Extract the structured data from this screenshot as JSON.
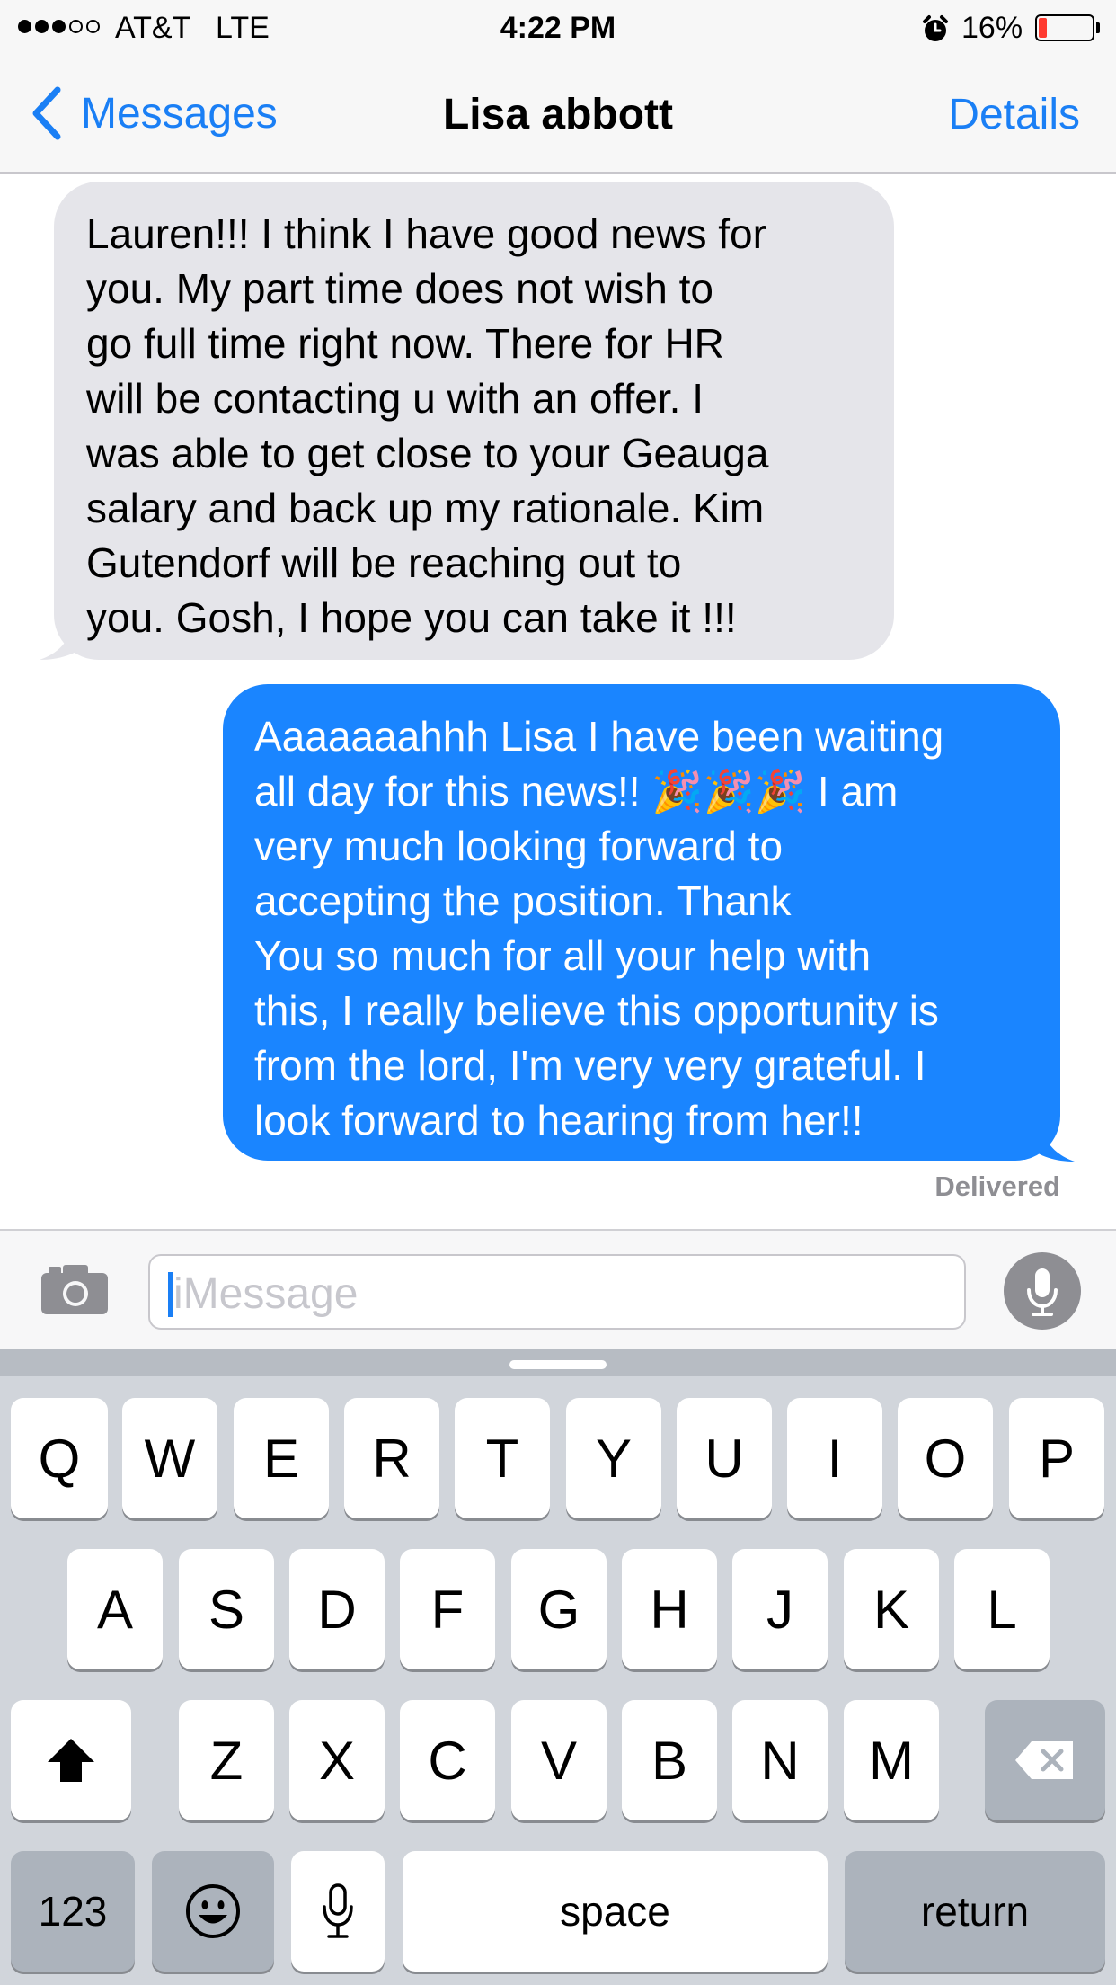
{
  "status_bar": {
    "signal": [
      true,
      true,
      true,
      false,
      false
    ],
    "carrier": "AT&T",
    "network": "LTE",
    "time": "4:22 PM",
    "alarm_icon": "alarm-clock-icon",
    "battery_percent": "16%",
    "battery_level": 0.16,
    "battery_color": "#ff3b30"
  },
  "nav": {
    "back_label": "Messages",
    "title": "Lisa abbott",
    "details_label": "Details"
  },
  "messages": [
    {
      "direction": "incoming",
      "text": "Lauren!!! I think I have good news for\nyou. My part time does not wish to\ngo full time right now. There for HR\nwill be contacting u with an offer. I\nwas able to get close to your Geauga\nsalary and back up my rationale. Kim\nGutendorf will be reaching out to\nyou. Gosh, I hope you can take it !!!"
    },
    {
      "direction": "outgoing",
      "text": "Aaaaaaahhh Lisa I have been waiting\nall day for this news!! 🎉🎉🎉 I am\nvery much looking forward to\naccepting the position. Thank\nYou so much for all your help with\nthis, I really believe this opportunity is\nfrom the lord, I'm very very grateful. I\nlook forward to hearing from her!!",
      "status": "Delivered"
    }
  ],
  "input_bar": {
    "camera_icon": "camera-icon",
    "placeholder": "iMessage",
    "mic_icon": "microphone-icon"
  },
  "keyboard": {
    "row1": [
      "Q",
      "W",
      "E",
      "R",
      "T",
      "Y",
      "U",
      "I",
      "O",
      "P"
    ],
    "row2": [
      "A",
      "S",
      "D",
      "F",
      "G",
      "H",
      "J",
      "K",
      "L"
    ],
    "row3": [
      "Z",
      "X",
      "C",
      "V",
      "B",
      "N",
      "M"
    ],
    "numbers_label": "123",
    "space_label": "space",
    "return_label": "return",
    "shift_icon": "shift-icon",
    "delete_icon": "delete-icon",
    "emoji_icon": "emoji-icon",
    "dictation_icon": "microphone-icon"
  },
  "colors": {
    "accent": "#1a7ff5",
    "outgoing_bubble": "#1a85ff",
    "incoming_bubble": "#e5e5ea"
  }
}
